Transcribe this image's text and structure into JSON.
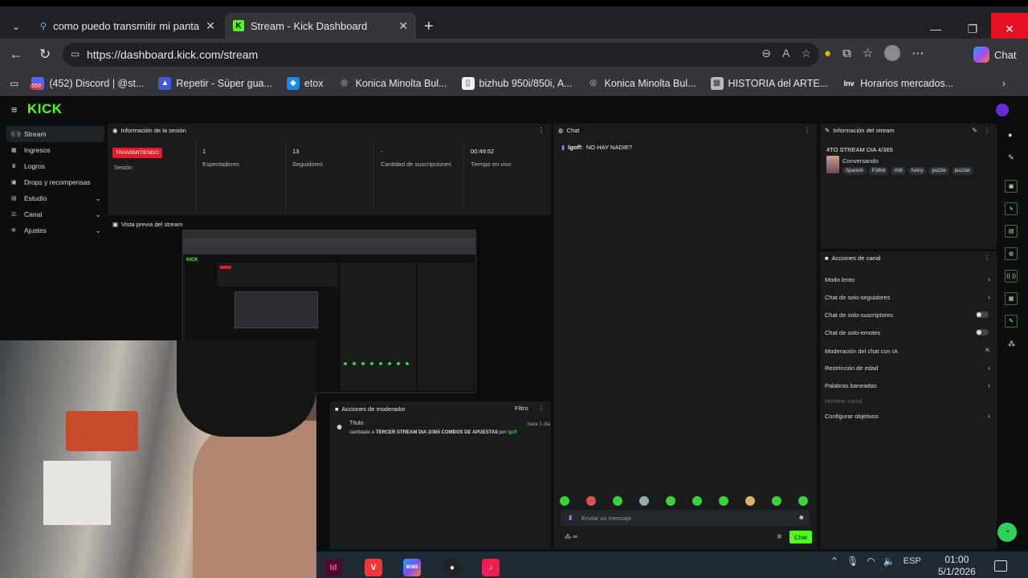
{
  "browser": {
    "tabs": [
      {
        "title": "como puedo transmitir mi pantalla",
        "active": false
      },
      {
        "title": "Stream - Kick Dashboard",
        "active": true
      }
    ],
    "url": "https://dashboard.kick.com/stream",
    "chat_button": "Chat",
    "bookmarks": [
      {
        "label": "(452) Discord | @st...",
        "badge": "559"
      },
      {
        "label": "Repetir - Súper gua..."
      },
      {
        "label": "etox"
      },
      {
        "label": "Konica Minolta Bul..."
      },
      {
        "label": "bizhub 950i/850i, A..."
      },
      {
        "label": "Konica Minolta Bul..."
      },
      {
        "label": "HISTORIA del ARTE..."
      },
      {
        "label": "Horarios mercados..."
      }
    ]
  },
  "kick": {
    "logo": "KICK",
    "sidebar": [
      {
        "label": "Stream",
        "icon": "antenna-icon",
        "active": true
      },
      {
        "label": "Ingresos",
        "icon": "money-icon"
      },
      {
        "label": "Logros",
        "icon": "trophy-icon"
      },
      {
        "label": "Drops y recompensas",
        "icon": "gift-icon"
      },
      {
        "label": "Estudio",
        "icon": "studio-icon",
        "expandable": true
      },
      {
        "label": "Canal",
        "icon": "channel-icon",
        "expandable": true
      },
      {
        "label": "Ajustes",
        "icon": "gear-icon",
        "expandable": true
      }
    ],
    "session": {
      "title": "Información de la sesión",
      "live_badge": "TRANSMITIENDO",
      "stats": [
        {
          "value": "",
          "label": "Sesión"
        },
        {
          "value": "1",
          "label": "Espectadores"
        },
        {
          "value": "13",
          "label": "Seguidores"
        },
        {
          "value": "-",
          "label": "Cantidad de suscripciones"
        },
        {
          "value": "00:49:52",
          "label": "Tiempo en vivo"
        }
      ]
    },
    "preview": {
      "title": "Vista previa del stream"
    },
    "mod_actions": {
      "title": "Acciones de moderador",
      "filter": "Filtro",
      "entry_label": "Título",
      "entry_time": "hace 1 día",
      "entry_text": "cambiado a",
      "entry_value": "TERCER STREAM DIA 2/365 COMBOS DE APUESTAS",
      "entry_by": "por",
      "entry_user": "lgoff"
    },
    "chat": {
      "title": "Chat",
      "message_user": "lgoff:",
      "message_text": "NO HAY NADIE?",
      "input_placeholder": "Enviar un mensaje",
      "send_label": "Chat",
      "points": "∞"
    },
    "stream_info": {
      "title": "Información del stream",
      "stream_title": "4TO STREAM DIA 4/365",
      "category": "Conversando",
      "tags": [
        "Spanish",
        "Fútbol",
        "chill",
        "funny",
        "puzzle",
        "puzzler"
      ]
    },
    "channel_actions": {
      "title": "Acciones de canal",
      "items": [
        {
          "label": "Modo lento",
          "control": "chevron"
        },
        {
          "label": "Chat de solo-seguidores",
          "control": "chevron"
        },
        {
          "label": "Chat de solo-suscriptores",
          "control": "toggle"
        },
        {
          "label": "Chat de solo-emotes",
          "control": "toggle"
        },
        {
          "label": "Moderación del chat con IA",
          "control": "external"
        },
        {
          "label": "Restricción de edad",
          "control": "chevron"
        },
        {
          "label": "Palabras baneadas",
          "control": "chevron"
        },
        {
          "label": "Hostear canal",
          "control": "none",
          "disabled": true
        },
        {
          "label": "Configurar objetivos",
          "control": "chevron"
        }
      ]
    }
  },
  "taskbar": {
    "apps": [
      "Id",
      "Vivaldi",
      "M365",
      "OBS",
      "TikTok"
    ],
    "language": "ESP",
    "time": "01:00",
    "date": "5/1/2026"
  }
}
